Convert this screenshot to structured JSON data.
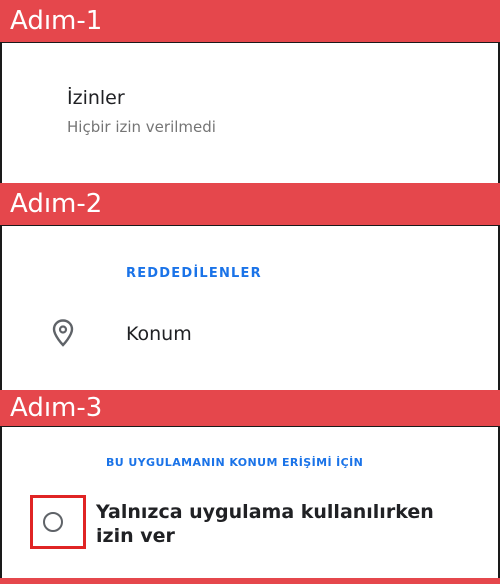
{
  "steps": [
    {
      "label": "Adım-1"
    },
    {
      "label": "Adım-2"
    },
    {
      "label": "Adım-3"
    }
  ],
  "step1": {
    "title": "İzinler",
    "subtitle": "Hiçbir izin verilmedi"
  },
  "step2": {
    "section_header": "REDDEDİLENLER",
    "permission_label": "Konum",
    "icon": "location-pin-icon"
  },
  "step3": {
    "section_header": "BU UYGULAMANIN KONUM ERİŞİMİ İÇİN",
    "option_label": "Yalnızca uygulama kullanılırken izin ver",
    "option_selected": false,
    "highlight_color": "#e02424"
  },
  "colors": {
    "header_bg": "#e5474c",
    "accent_blue": "#1a73e8"
  }
}
